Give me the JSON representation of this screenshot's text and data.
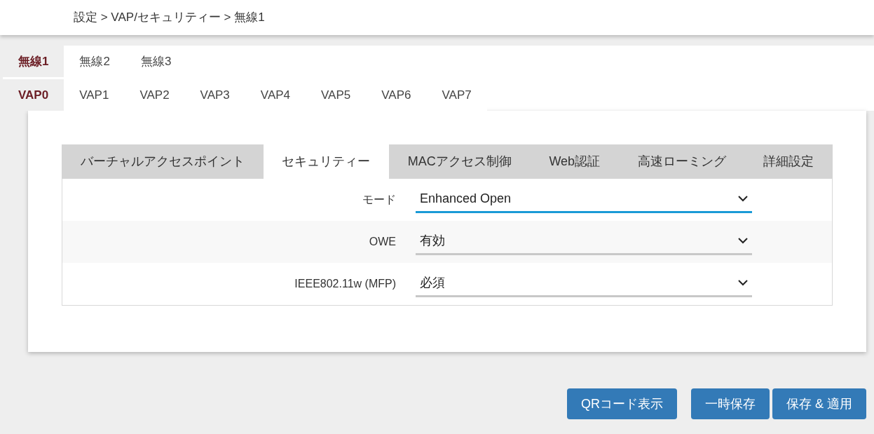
{
  "breadcrumb": "設定 > VAP/セキュリティー > 無線1",
  "radio_tabs": [
    {
      "label": "無線1",
      "selected": true
    },
    {
      "label": "無線2",
      "selected": false
    },
    {
      "label": "無線3",
      "selected": false
    }
  ],
  "vap_tabs": [
    {
      "label": "VAP0",
      "selected": true
    },
    {
      "label": "VAP1",
      "selected": false
    },
    {
      "label": "VAP2",
      "selected": false
    },
    {
      "label": "VAP3",
      "selected": false
    },
    {
      "label": "VAP4",
      "selected": false
    },
    {
      "label": "VAP5",
      "selected": false
    },
    {
      "label": "VAP6",
      "selected": false
    },
    {
      "label": "VAP7",
      "selected": false
    }
  ],
  "section_tabs": [
    {
      "label": "バーチャルアクセスポイント",
      "selected": false
    },
    {
      "label": "セキュリティー",
      "selected": true
    },
    {
      "label": "MACアクセス制御",
      "selected": false
    },
    {
      "label": "Web認証",
      "selected": false
    },
    {
      "label": "高速ローミング",
      "selected": false
    },
    {
      "label": "詳細設定",
      "selected": false
    }
  ],
  "fields": [
    {
      "label": "モード",
      "value": "Enhanced Open",
      "focused": true
    },
    {
      "label": "OWE",
      "value": "有効",
      "focused": false
    },
    {
      "label": "IEEE802.11w (MFP)",
      "value": "必須",
      "focused": false
    }
  ],
  "buttons": [
    "QRコード表示",
    "一時保存",
    "保存 & 適用"
  ]
}
